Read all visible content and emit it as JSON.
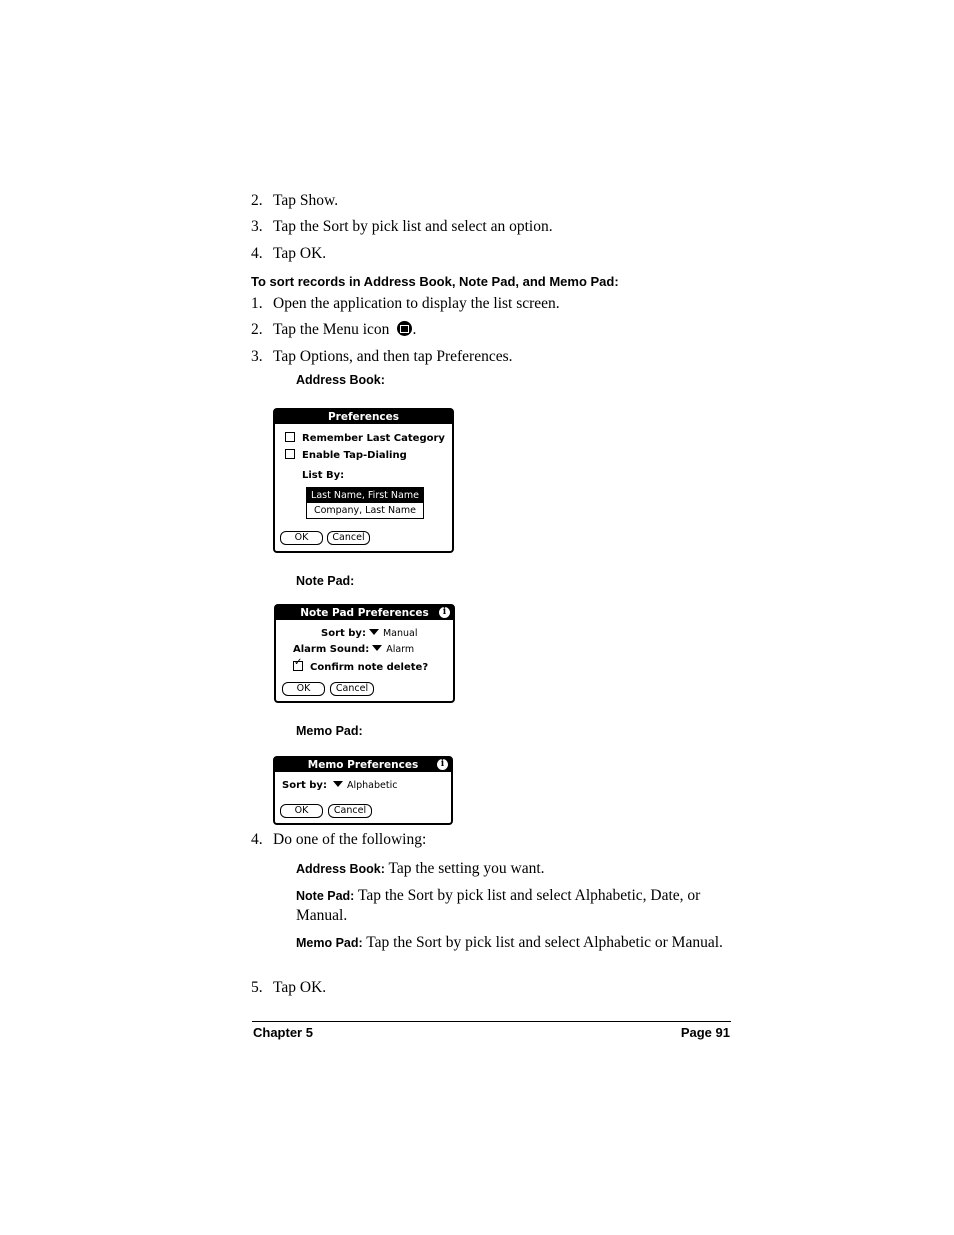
{
  "steps_top": [
    {
      "num": "2.",
      "text": "Tap Show."
    },
    {
      "num": "3.",
      "text": "Tap the Sort by pick list and select an option."
    },
    {
      "num": "4.",
      "text": "Tap OK."
    }
  ],
  "heading": "To sort records in Address Book, Note Pad, and Memo Pad:",
  "steps_main": [
    {
      "num": "1.",
      "text": "Open the application to display the list screen."
    },
    {
      "num": "2.",
      "text": "Tap the Menu icon",
      "suffix": ".",
      "icon": "menu-icon"
    },
    {
      "num": "3.",
      "text": "Tap Options, and then tap Preferences."
    }
  ],
  "labels": {
    "address_book": "Address Book:",
    "note_pad": "Note Pad:",
    "memo_pad": "Memo Pad:"
  },
  "address_dialog": {
    "title": "Preferences",
    "checkboxes": [
      {
        "label": "Remember Last Category",
        "checked": false
      },
      {
        "label": "Enable Tap-Dialing",
        "checked": false
      }
    ],
    "list_by_label": "List By:",
    "list_options": [
      {
        "label": "Last Name, First Name",
        "selected": true
      },
      {
        "label": "Company, Last Name",
        "selected": false
      }
    ],
    "ok": "OK",
    "cancel": "Cancel"
  },
  "notepad_dialog": {
    "title": "Note Pad Preferences",
    "info_icon": "i",
    "sort_by_label": "Sort by:",
    "sort_by_value": "Manual",
    "alarm_label": "Alarm Sound:",
    "alarm_value": "Alarm",
    "confirm_label": "Confirm note delete?",
    "confirm_checked": true,
    "ok": "OK",
    "cancel": "Cancel"
  },
  "memo_dialog": {
    "title": "Memo Preferences",
    "info_icon": "i",
    "sort_by_label": "Sort by:",
    "sort_by_value": "Alphabetic",
    "ok": "OK",
    "cancel": "Cancel"
  },
  "step4": {
    "num": "4.",
    "text": "Do one of the following:"
  },
  "instructions": [
    {
      "label": "Address Book:",
      "text": " Tap the setting you want."
    },
    {
      "label": "Note Pad:",
      "text": " Tap the Sort by pick list and select Alphabetic, Date, or Manual."
    },
    {
      "label": "Memo Pad:",
      "text": " Tap the Sort by pick list and select Alphabetic or Manual."
    }
  ],
  "step5": {
    "num": "5.",
    "text": "Tap OK."
  },
  "footer": {
    "chapter": "Chapter 5",
    "page": "Page 91"
  }
}
